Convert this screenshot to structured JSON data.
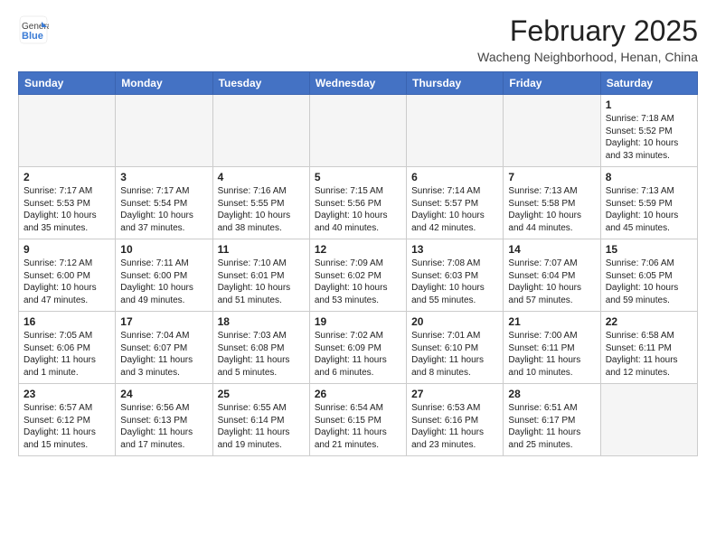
{
  "header": {
    "logo_general": "General",
    "logo_blue": "Blue",
    "month_year": "February 2025",
    "location": "Wacheng Neighborhood, Henan, China"
  },
  "weekdays": [
    "Sunday",
    "Monday",
    "Tuesday",
    "Wednesday",
    "Thursday",
    "Friday",
    "Saturday"
  ],
  "weeks": [
    [
      {
        "day": "",
        "info": ""
      },
      {
        "day": "",
        "info": ""
      },
      {
        "day": "",
        "info": ""
      },
      {
        "day": "",
        "info": ""
      },
      {
        "day": "",
        "info": ""
      },
      {
        "day": "",
        "info": ""
      },
      {
        "day": "1",
        "info": "Sunrise: 7:18 AM\nSunset: 5:52 PM\nDaylight: 10 hours\nand 33 minutes."
      }
    ],
    [
      {
        "day": "2",
        "info": "Sunrise: 7:17 AM\nSunset: 5:53 PM\nDaylight: 10 hours\nand 35 minutes."
      },
      {
        "day": "3",
        "info": "Sunrise: 7:17 AM\nSunset: 5:54 PM\nDaylight: 10 hours\nand 37 minutes."
      },
      {
        "day": "4",
        "info": "Sunrise: 7:16 AM\nSunset: 5:55 PM\nDaylight: 10 hours\nand 38 minutes."
      },
      {
        "day": "5",
        "info": "Sunrise: 7:15 AM\nSunset: 5:56 PM\nDaylight: 10 hours\nand 40 minutes."
      },
      {
        "day": "6",
        "info": "Sunrise: 7:14 AM\nSunset: 5:57 PM\nDaylight: 10 hours\nand 42 minutes."
      },
      {
        "day": "7",
        "info": "Sunrise: 7:13 AM\nSunset: 5:58 PM\nDaylight: 10 hours\nand 44 minutes."
      },
      {
        "day": "8",
        "info": "Sunrise: 7:13 AM\nSunset: 5:59 PM\nDaylight: 10 hours\nand 45 minutes."
      }
    ],
    [
      {
        "day": "9",
        "info": "Sunrise: 7:12 AM\nSunset: 6:00 PM\nDaylight: 10 hours\nand 47 minutes."
      },
      {
        "day": "10",
        "info": "Sunrise: 7:11 AM\nSunset: 6:00 PM\nDaylight: 10 hours\nand 49 minutes."
      },
      {
        "day": "11",
        "info": "Sunrise: 7:10 AM\nSunset: 6:01 PM\nDaylight: 10 hours\nand 51 minutes."
      },
      {
        "day": "12",
        "info": "Sunrise: 7:09 AM\nSunset: 6:02 PM\nDaylight: 10 hours\nand 53 minutes."
      },
      {
        "day": "13",
        "info": "Sunrise: 7:08 AM\nSunset: 6:03 PM\nDaylight: 10 hours\nand 55 minutes."
      },
      {
        "day": "14",
        "info": "Sunrise: 7:07 AM\nSunset: 6:04 PM\nDaylight: 10 hours\nand 57 minutes."
      },
      {
        "day": "15",
        "info": "Sunrise: 7:06 AM\nSunset: 6:05 PM\nDaylight: 10 hours\nand 59 minutes."
      }
    ],
    [
      {
        "day": "16",
        "info": "Sunrise: 7:05 AM\nSunset: 6:06 PM\nDaylight: 11 hours\nand 1 minute."
      },
      {
        "day": "17",
        "info": "Sunrise: 7:04 AM\nSunset: 6:07 PM\nDaylight: 11 hours\nand 3 minutes."
      },
      {
        "day": "18",
        "info": "Sunrise: 7:03 AM\nSunset: 6:08 PM\nDaylight: 11 hours\nand 5 minutes."
      },
      {
        "day": "19",
        "info": "Sunrise: 7:02 AM\nSunset: 6:09 PM\nDaylight: 11 hours\nand 6 minutes."
      },
      {
        "day": "20",
        "info": "Sunrise: 7:01 AM\nSunset: 6:10 PM\nDaylight: 11 hours\nand 8 minutes."
      },
      {
        "day": "21",
        "info": "Sunrise: 7:00 AM\nSunset: 6:11 PM\nDaylight: 11 hours\nand 10 minutes."
      },
      {
        "day": "22",
        "info": "Sunrise: 6:58 AM\nSunset: 6:11 PM\nDaylight: 11 hours\nand 12 minutes."
      }
    ],
    [
      {
        "day": "23",
        "info": "Sunrise: 6:57 AM\nSunset: 6:12 PM\nDaylight: 11 hours\nand 15 minutes."
      },
      {
        "day": "24",
        "info": "Sunrise: 6:56 AM\nSunset: 6:13 PM\nDaylight: 11 hours\nand 17 minutes."
      },
      {
        "day": "25",
        "info": "Sunrise: 6:55 AM\nSunset: 6:14 PM\nDaylight: 11 hours\nand 19 minutes."
      },
      {
        "day": "26",
        "info": "Sunrise: 6:54 AM\nSunset: 6:15 PM\nDaylight: 11 hours\nand 21 minutes."
      },
      {
        "day": "27",
        "info": "Sunrise: 6:53 AM\nSunset: 6:16 PM\nDaylight: 11 hours\nand 23 minutes."
      },
      {
        "day": "28",
        "info": "Sunrise: 6:51 AM\nSunset: 6:17 PM\nDaylight: 11 hours\nand 25 minutes."
      },
      {
        "day": "",
        "info": ""
      }
    ]
  ]
}
